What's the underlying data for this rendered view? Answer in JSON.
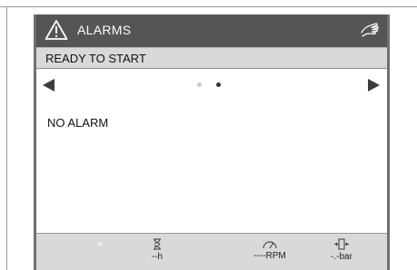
{
  "header": {
    "title": "ALARMS",
    "warning_icon": "warning-triangle-icon",
    "mode_icon": "hand-icon"
  },
  "status": {
    "text": "READY TO START"
  },
  "pager": {
    "total_pages": 2,
    "current_page": 2
  },
  "alarms": {
    "message": "NO ALARM"
  },
  "footer": {
    "hours": {
      "icon": "hourglass-icon",
      "value": "--h"
    },
    "speed": {
      "icon": "gauge-icon",
      "value": "----RPM"
    },
    "pressure": {
      "icon": "pressure-icon",
      "value": "-.-bar"
    }
  },
  "colors": {
    "header_bg": "#555555",
    "panel_bg": "#d9d9d9",
    "content_bg": "#ffffff"
  }
}
